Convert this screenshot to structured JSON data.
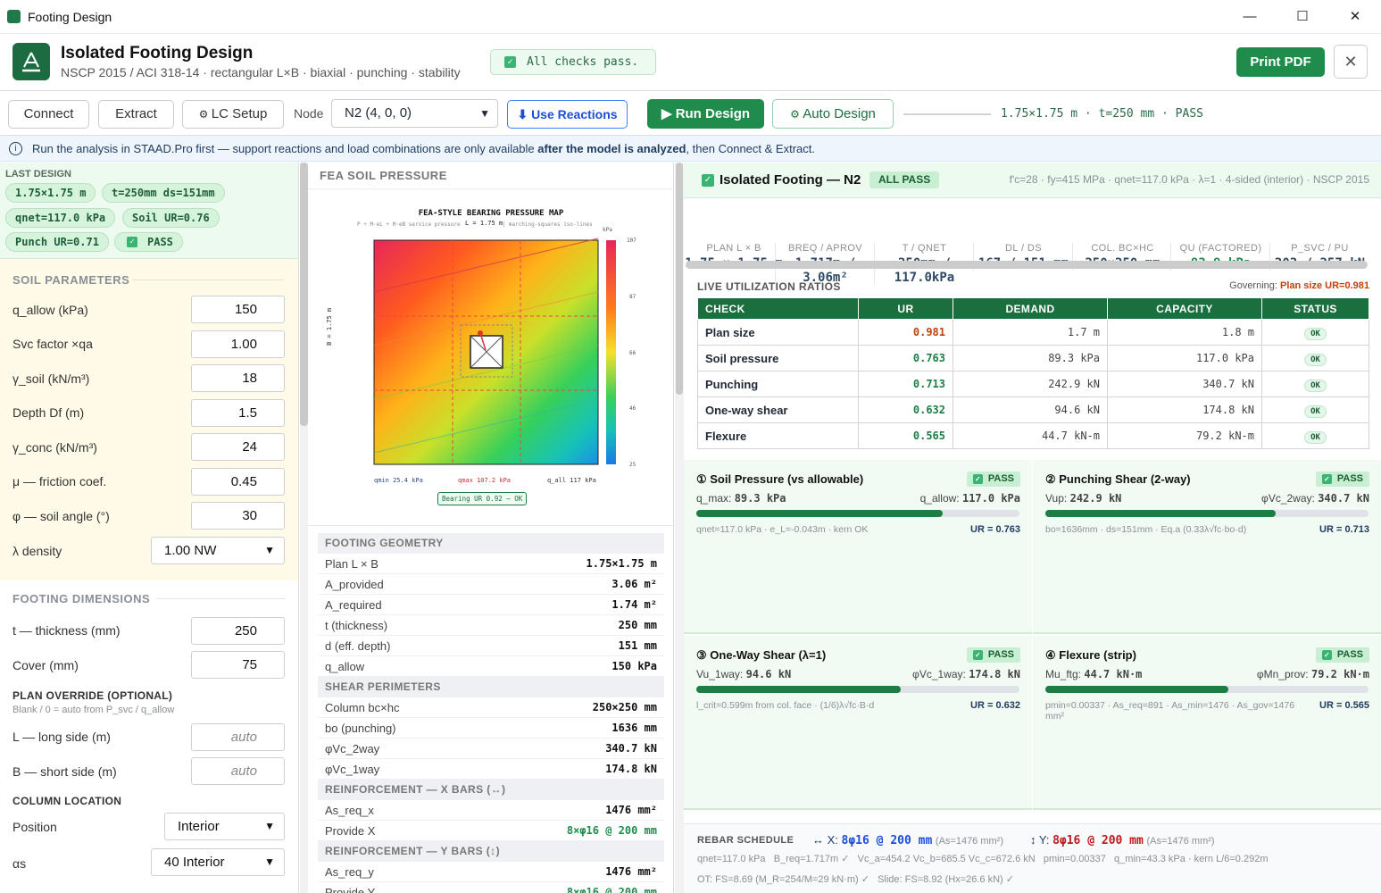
{
  "window": {
    "title": "Footing Design",
    "min": "—",
    "max": "☐",
    "close": "✕"
  },
  "header": {
    "title": "Isolated Footing Design",
    "subtitle": "NSCP 2015 / ACI 318-14 · rectangular L×B · biaxial · punching · stability",
    "checks": "All checks pass.",
    "print": "Print PDF",
    "close": "✕"
  },
  "toolbar": {
    "connect": "Connect",
    "extract": "Extract",
    "lcsetup": "LC Setup",
    "node_label": "Node",
    "node_value": "N2 (4, 0, 0)",
    "use_reactions": "Use Reactions",
    "run": "Run Design",
    "auto": "Auto Design",
    "status": "1.75×1.75 m · t=250 mm · PASS"
  },
  "info": {
    "pre": "Run the analysis in STAAD.Pro first — support reactions and load combinations are only available ",
    "bold": "after the model is analyzed",
    "post": ", then Connect & Extract."
  },
  "last_design": {
    "label": "LAST DESIGN",
    "chips": [
      "1.75×1.75 m",
      "t=250mm ds=151mm",
      "qnet=117.0 kPa",
      "Soil UR=0.76",
      "Punch UR=0.71",
      "PASS"
    ]
  },
  "soil": {
    "heading": "SOIL PARAMETERS",
    "fields": [
      {
        "label": "q_allow (kPa)",
        "value": "150"
      },
      {
        "label": "Svc factor ×qa",
        "value": "1.00"
      },
      {
        "label": "γ_soil (kN/m³)",
        "value": "18"
      },
      {
        "label": "Depth Df (m)",
        "value": "1.5"
      },
      {
        "label": "γ_conc (kN/m³)",
        "value": "24"
      },
      {
        "label": "μ — friction coef.",
        "value": "0.45"
      },
      {
        "label": "φ — soil angle (°)",
        "value": "30"
      }
    ],
    "density_label": "λ density",
    "density_value": "1.00 NW"
  },
  "dims": {
    "heading": "FOOTING DIMENSIONS",
    "thickness_label": "t — thickness (mm)",
    "thickness": "250",
    "cover_label": "Cover (mm)",
    "cover": "75",
    "override_head": "PLAN OVERRIDE (OPTIONAL)",
    "override_hint": "Blank / 0 = auto from P_svc / q_allow",
    "L_label": "L — long side (m)",
    "L_placeholder": "auto",
    "B_label": "B — short side (m)",
    "B_placeholder": "auto",
    "colloc_head": "COLUMN LOCATION",
    "position_label": "Position",
    "position": "Interior",
    "as_label": "αs",
    "as": "40 Interior"
  },
  "fea": {
    "heading": "FEA SOIL PRESSURE",
    "title": "FEA-STYLE BEARING PRESSURE MAP",
    "subtitle": "P + M·eL + M·eB service pressure · 1.75 mesh | marching-squares iso-lines",
    "top_dim": "L = 1.75 m",
    "side_dim": "B = 1.75 m",
    "unit": "kPa",
    "scale": [
      "107",
      "87",
      "66",
      "46",
      "25"
    ],
    "qmin": "qmin 25.4 kPa",
    "qmax": "qmax 107.2 kPa",
    "qall": "q_all 117 kPa",
    "bearing": "Bearing UR 0.92 — OK"
  },
  "geometry": [
    {
      "head": "FOOTING GEOMETRY"
    },
    {
      "k": "Plan L × B",
      "v": "1.75×1.75 m"
    },
    {
      "k": "A_provided",
      "v": "3.06 m²"
    },
    {
      "k": "A_required",
      "v": "1.74 m²"
    },
    {
      "k": "t (thickness)",
      "v": "250 mm"
    },
    {
      "k": "d (eff. depth)",
      "v": "151 mm"
    },
    {
      "k": "q_allow",
      "v": "150 kPa"
    },
    {
      "head": "SHEAR PERIMETERS"
    },
    {
      "k": "Column bc×hc",
      "v": "250×250 mm"
    },
    {
      "k": "bo (punching)",
      "v": "1636 mm"
    },
    {
      "k": "φVc_2way",
      "v": "340.7 kN"
    },
    {
      "k": "φVc_1way",
      "v": "174.8 kN"
    },
    {
      "head": "REINFORCEMENT — X BARS (↔)"
    },
    {
      "k": "As_req_x",
      "v": "1476 mm²"
    },
    {
      "k": "Provide X",
      "v": "8×φ16 @ 200 mm",
      "green": true
    },
    {
      "head": "REINFORCEMENT — Y BARS (↕)"
    },
    {
      "k": "As_req_y",
      "v": "1476 mm²"
    },
    {
      "k": "Provide Y",
      "v": "8×φ16 @ 200 mm",
      "green": true
    }
  ],
  "result": {
    "title": "Isolated Footing — N2",
    "badge": "ALL PASS",
    "meta": "f'c=28 · fy=415 MPa · qnet=117.0 kPa · λ=1 · 4-sided (interior) · NSCP 2015",
    "summary": [
      {
        "l": "PLAN L × B",
        "v": "1.75 × 1.75 m"
      },
      {
        "l": "BREQ / APROV",
        "v": "1.717m / 3.06m²"
      },
      {
        "l": "T / QNET",
        "v": "250mm / 117.0kPa"
      },
      {
        "l": "DL / DS",
        "v": "167 / 151 mm"
      },
      {
        "l": "COL. BC×HC",
        "v": "250×250 mm"
      },
      {
        "l": "QU (FACTORED)",
        "v": "83.9 kPa",
        "green": true
      },
      {
        "l": "P_SVC / PU",
        "v": "203 / 257 kN"
      }
    ],
    "ur_heading": "LIVE UTILIZATION RATIOS",
    "governing_label": "Governing:",
    "governing_value": "Plan size UR=0.981",
    "table_head": [
      "CHECK",
      "UR",
      "DEMAND",
      "CAPACITY",
      "STATUS"
    ],
    "rows": [
      {
        "check": "Plan size",
        "ur": "0.981",
        "demand": "1.7 m",
        "capacity": "1.8 m",
        "status": "OK",
        "warn": true
      },
      {
        "check": "Soil pressure",
        "ur": "0.763",
        "demand": "89.3 kPa",
        "capacity": "117.0 kPa",
        "status": "OK"
      },
      {
        "check": "Punching",
        "ur": "0.713",
        "demand": "242.9 kN",
        "capacity": "340.7 kN",
        "status": "OK"
      },
      {
        "check": "One-way shear",
        "ur": "0.632",
        "demand": "94.6 kN",
        "capacity": "174.8 kN",
        "status": "OK"
      },
      {
        "check": "Flexure",
        "ur": "0.565",
        "demand": "44.7 kN-m",
        "capacity": "79.2 kN-m",
        "status": "OK"
      }
    ],
    "cards": [
      {
        "title": "① Soil Pressure (vs allowable)",
        "pass": "PASS",
        "dl": "q_max:",
        "dlv": "89.3 kPa",
        "dr": "q_allow:",
        "drv": "117.0 kPa",
        "fill": 0.763,
        "foot": "qnet=117.0 kPa · e_L=-0.043m · kern OK",
        "ur": "UR = 0.763"
      },
      {
        "title": "② Punching Shear (2-way)",
        "pass": "PASS",
        "dl": "Vup:",
        "dlv": "242.9 kN",
        "dr": "φVc_2way:",
        "drv": "340.7 kN",
        "fill": 0.713,
        "foot": "bo=1636mm · ds=151mm · Eq.a (0.33λ√fc·bo·d)",
        "ur": "UR = 0.713"
      },
      {
        "title": "③ One-Way Shear (λ=1)",
        "pass": "PASS",
        "dl": "Vu_1way:",
        "dlv": "94.6 kN",
        "dr": "φVc_1way:",
        "drv": "174.8 kN",
        "fill": 0.632,
        "foot": "l_crit=0.599m from col. face · (1/6)λ√fc·B·d",
        "ur": "UR = 0.632"
      },
      {
        "title": "④ Flexure (strip)",
        "pass": "PASS",
        "dl": "Mu_ftg:",
        "dlv": "44.7 kN·m",
        "dr": "φMn_prov:",
        "drv": "79.2 kN·m",
        "fill": 0.565,
        "foot": "pmin=0.00337 · As_req=891 · As_min=1476 · As_gov=1476 mm²",
        "ur": "UR = 0.565"
      }
    ],
    "rebar": {
      "heading": "REBAR SCHEDULE",
      "x_label": "↔ X:",
      "x_value": "8φ16 @ 200 mm",
      "x_note": "(As=1476 mm²)",
      "y_label": "↕ Y:",
      "y_value": "8φ16 @ 200 mm",
      "y_note": "(As=1476 mm²)",
      "line1": "qnet=117.0 kPa   B_req=1.717m ✓   Vc_a=454.2 Vc_b=685.5 Vc_c=672.6 kN   pmin=0.00337   q_min=43.3 kPa · kern L/6=0.292m",
      "line2": "OT: FS=8.69 (M_R=254/M=29 kN·m) ✓   Slide: FS=8.92 (Hx=26.6 kN) ✓"
    }
  },
  "colors": {
    "accent": "#1e8c4b",
    "warn": "#c2410c",
    "info": "#1d4ed8"
  }
}
